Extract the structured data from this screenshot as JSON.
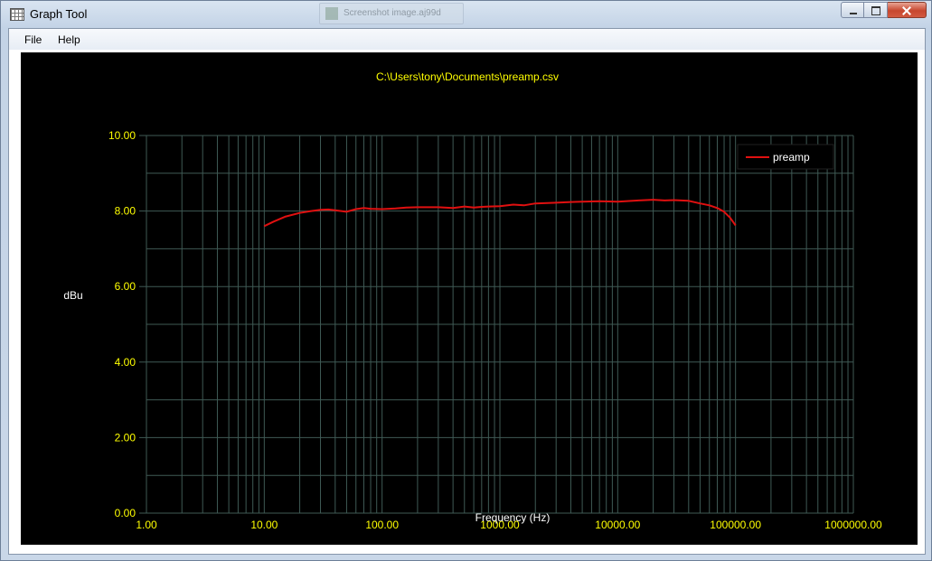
{
  "window": {
    "title": "Graph Tool",
    "background_tab_title": "Screenshot image.aj99d"
  },
  "menu": {
    "file_label": "File",
    "help_label": "Help"
  },
  "colors": {
    "plot_background": "#000000",
    "grid": "#3f5a55",
    "axis_text": "#ffff00",
    "label_text": "#ffffff",
    "series": "#e01010"
  },
  "chart_data": {
    "type": "line",
    "title": "C:\\Users\\tony\\Documents\\preamp.csv",
    "xlabel": "Frequency (Hz)",
    "ylabel": "dBu",
    "x_scale": "log",
    "xlim": [
      1,
      1000000
    ],
    "ylim": [
      0,
      10
    ],
    "grid": true,
    "legend_position": "top-right",
    "x_tick_labels": [
      "1.00",
      "10.00",
      "100.00",
      "1000.00",
      "10000.00",
      "100000.00",
      "1000000.00"
    ],
    "y_tick_labels": [
      "0.00",
      "2.00",
      "4.00",
      "6.00",
      "8.00",
      "10.00"
    ],
    "series": [
      {
        "name": "preamp",
        "color": "#e01010",
        "x": [
          10,
          12,
          15,
          20,
          25,
          30,
          35,
          40,
          50,
          60,
          70,
          80,
          100,
          130,
          160,
          200,
          250,
          300,
          400,
          500,
          600,
          700,
          800,
          1000,
          1300,
          1600,
          2000,
          3000,
          4000,
          5000,
          7000,
          10000,
          15000,
          20000,
          25000,
          30000,
          40000,
          50000,
          60000,
          70000,
          80000,
          90000,
          100000
        ],
        "y": [
          7.6,
          7.72,
          7.85,
          7.95,
          8.0,
          8.03,
          8.04,
          8.02,
          7.98,
          8.05,
          8.08,
          8.06,
          8.05,
          8.07,
          8.09,
          8.1,
          8.1,
          8.1,
          8.08,
          8.12,
          8.09,
          8.11,
          8.12,
          8.13,
          8.17,
          8.15,
          8.2,
          8.22,
          8.24,
          8.25,
          8.26,
          8.25,
          8.28,
          8.3,
          8.28,
          8.29,
          8.27,
          8.2,
          8.15,
          8.08,
          7.98,
          7.82,
          7.62
        ]
      }
    ]
  }
}
